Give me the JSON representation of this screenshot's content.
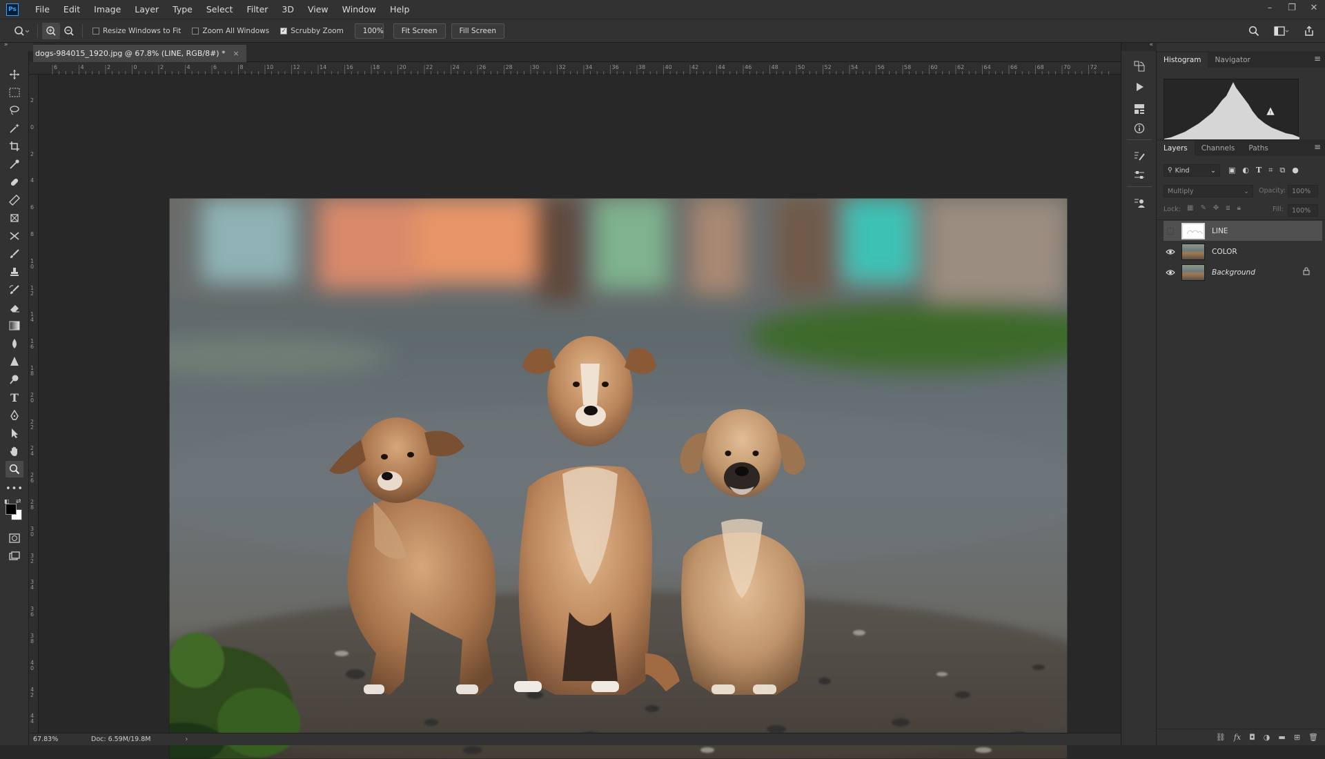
{
  "app": {
    "logo": "Ps",
    "colors": {
      "menubar": "#323232",
      "canvas_bg": "#282828",
      "accent": "#31a8ff"
    }
  },
  "menubar": {
    "items": [
      "File",
      "Edit",
      "Image",
      "Layer",
      "Type",
      "Select",
      "Filter",
      "3D",
      "View",
      "Window",
      "Help"
    ]
  },
  "window_controls": {
    "minimize": "–",
    "restore": "❐",
    "close": "✕"
  },
  "options_bar": {
    "tool_icon": "zoom-icon",
    "resize_windows": {
      "label": "Resize Windows to Fit",
      "checked": false
    },
    "zoom_all": {
      "label": "Zoom All Windows",
      "checked": false
    },
    "scrubby_zoom": {
      "label": "Scrubby Zoom",
      "checked": true
    },
    "zoom_value": "100%",
    "fit_screen": "Fit Screen",
    "fill_screen": "Fill Screen"
  },
  "document": {
    "tab_title": "dogs-984015_1920.jpg @ 67.8% (LINE, RGB/8#) *",
    "close": "×"
  },
  "ruler": {
    "h_labels": [
      "6",
      "4",
      "2",
      "0",
      "2",
      "4",
      "6",
      "8",
      "10",
      "12",
      "14",
      "16",
      "18",
      "20",
      "22",
      "24",
      "26",
      "28",
      "30",
      "32",
      "34",
      "36",
      "38",
      "40",
      "42",
      "44",
      "46",
      "48",
      "50",
      "52",
      "54",
      "56",
      "58",
      "60",
      "62",
      "64",
      "66",
      "68",
      "70",
      "72"
    ],
    "v_labels": [
      "2",
      "0",
      "2",
      "4",
      "6",
      "8",
      "1 0",
      "1 2",
      "1 4",
      "1 6",
      "1 8",
      "2 0",
      "2 2",
      "2 4",
      "2 6",
      "2 8",
      "3 0",
      "3 2",
      "3 4",
      "3 6",
      "3 8",
      "4 0",
      "4 2",
      "4 4"
    ]
  },
  "status_bar": {
    "zoom": "67.83%",
    "doc": "Doc: 6.59M/19.8M",
    "arrow": "›"
  },
  "panels": {
    "top_tabs": [
      "Histogram",
      "Navigator"
    ],
    "layer_tabs": [
      "Layers",
      "Channels",
      "Paths"
    ],
    "kind_filter": "Kind",
    "blend_mode": "Multiply",
    "opacity_label": "Opacity:",
    "opacity_value": "100%",
    "lock_label": "Lock:",
    "fill_label": "Fill:",
    "fill_value": "100%",
    "layers": [
      {
        "name": "LINE",
        "visible": false,
        "selected": true,
        "italic": false,
        "locked": false
      },
      {
        "name": "COLOR",
        "visible": true,
        "selected": false,
        "italic": false,
        "locked": false
      },
      {
        "name": "Background",
        "visible": true,
        "selected": false,
        "italic": true,
        "locked": true
      }
    ]
  },
  "tools": [
    "move-icon",
    "marquee-icon",
    "lasso-icon",
    "magic-wand-icon",
    "crop-icon",
    "eyedropper-icon",
    "healing-brush-icon",
    "ruler-icon",
    "frame-icon",
    "content-aware-move-icon",
    "brush-icon",
    "clone-stamp-icon",
    "history-brush-icon",
    "eraser-icon",
    "gradient-icon",
    "blur-icon",
    "sharpen-icon",
    "dodge-icon",
    "type-icon",
    "pen-icon",
    "path-selection-icon",
    "hand-icon",
    "zoom-icon",
    "more-tools-icon"
  ]
}
